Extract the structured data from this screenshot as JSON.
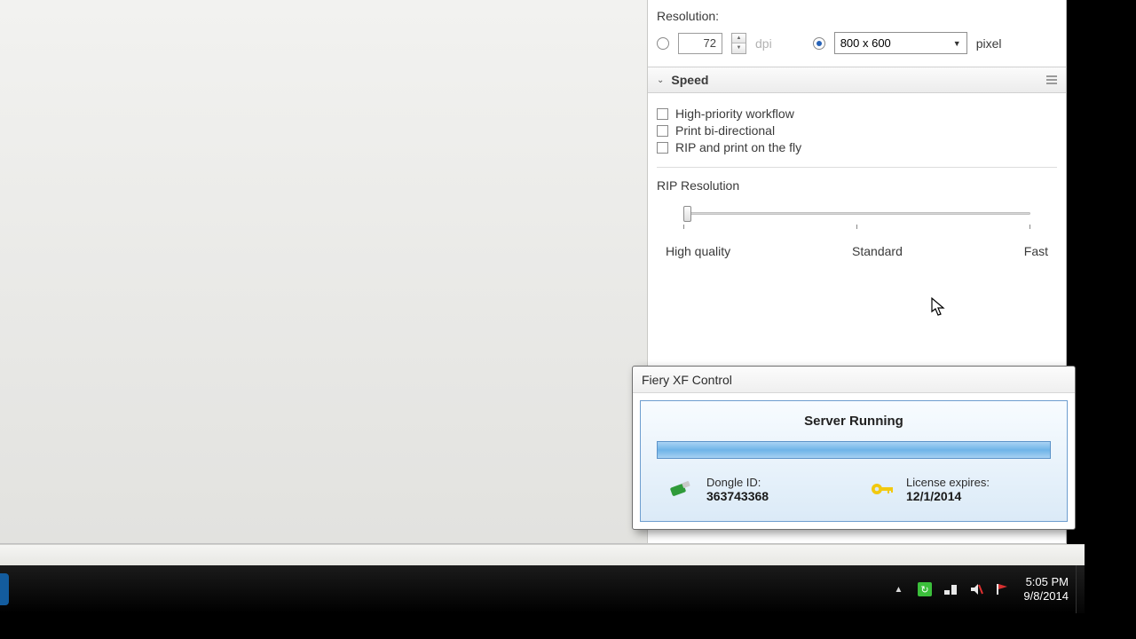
{
  "resolution": {
    "label": "Resolution:",
    "dpi_value": "72",
    "dpi_unit": "dpi",
    "pixel_value": "800 x 600",
    "pixel_unit": "pixel"
  },
  "speed": {
    "section_title": "Speed",
    "opt_high_priority": "High-priority workflow",
    "opt_bidir": "Print bi-directional",
    "opt_rip_fly": "RIP and print on the fly",
    "rip_label": "RIP Resolution",
    "tick_high": "High quality",
    "tick_standard": "Standard",
    "tick_fast": "Fast"
  },
  "popup": {
    "title": "Fiery XF Control",
    "status": "Server Running",
    "dongle_label": "Dongle ID:",
    "dongle_value": "363743368",
    "license_label": "License expires:",
    "license_value": "12/1/2014"
  },
  "taskbar": {
    "time": "5:05 PM",
    "date": "9/8/2014"
  }
}
